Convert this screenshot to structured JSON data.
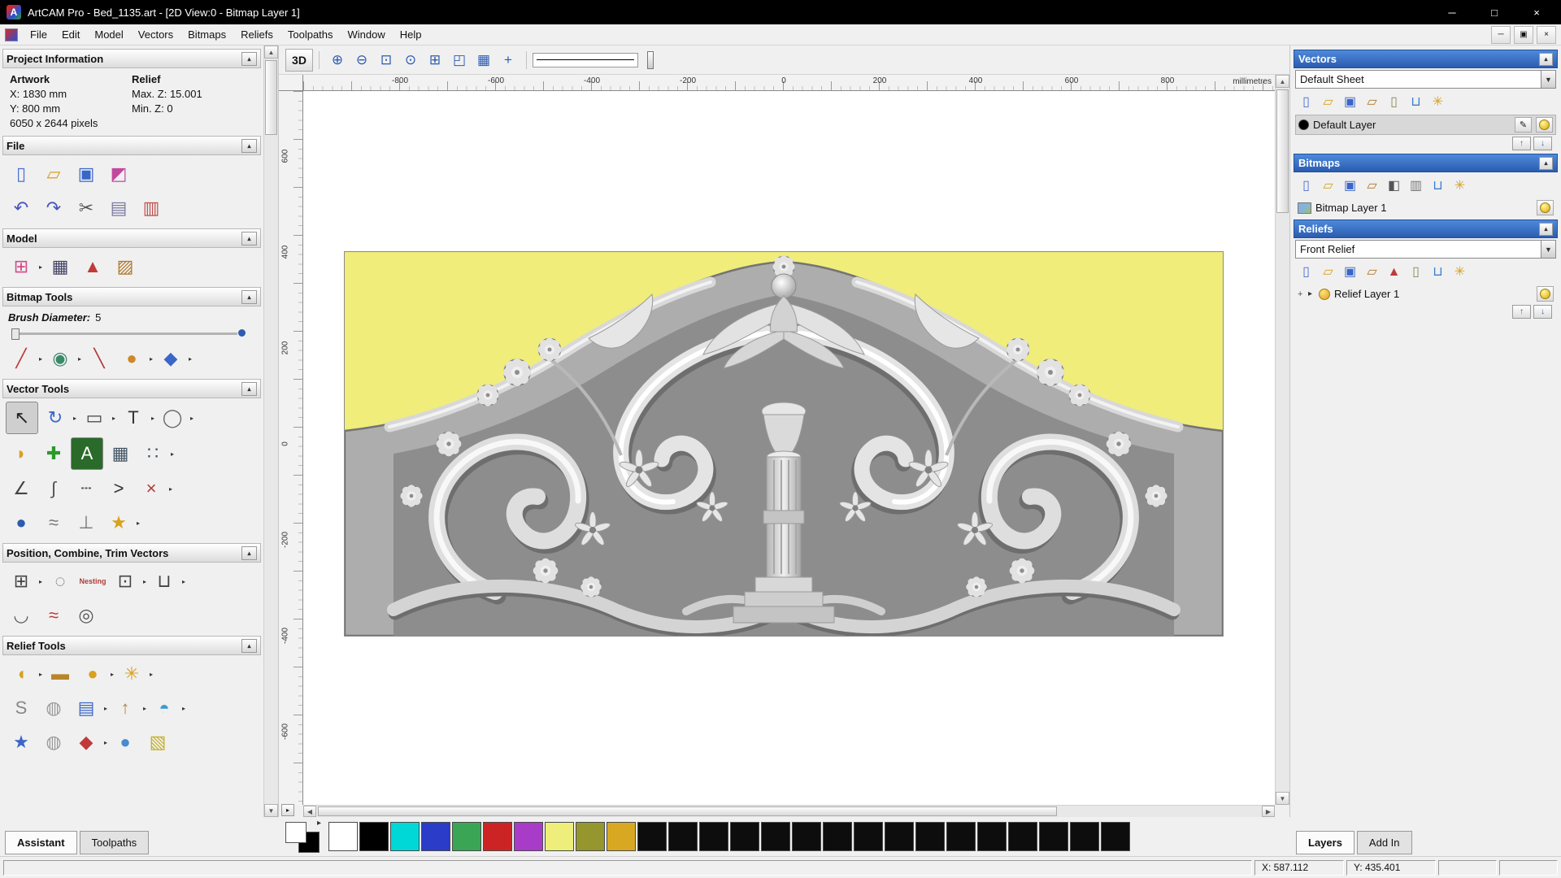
{
  "ui": {
    "rollup": "▴",
    "flyout": "▸",
    "dropdown": "▼",
    "up": "↑",
    "down": "↓",
    "uparrow": "▲",
    "downarrow": "▼",
    "left": "◀",
    "right": "▶",
    "expander": "▸",
    "plus": "+",
    "pencil": "✎",
    "pane": "▸"
  },
  "window": {
    "app_icon": "A",
    "title": "ArtCAM Pro - Bed_1135.art - [2D View:0 - Bitmap Layer 1]",
    "minimize": "─",
    "maximize": "□",
    "close": "×"
  },
  "menu": {
    "items": [
      {
        "name": "menu-file",
        "label": "File"
      },
      {
        "name": "menu-edit",
        "label": "Edit"
      },
      {
        "name": "menu-model",
        "label": "Model"
      },
      {
        "name": "menu-vectors",
        "label": "Vectors"
      },
      {
        "name": "menu-bitmaps",
        "label": "Bitmaps"
      },
      {
        "name": "menu-reliefs",
        "label": "Reliefs"
      },
      {
        "name": "menu-toolpaths",
        "label": "Toolpaths"
      },
      {
        "name": "menu-window",
        "label": "Window"
      },
      {
        "name": "menu-help",
        "label": "Help"
      }
    ],
    "mdi": {
      "minimize": "─",
      "restore": "▣",
      "close": "×"
    }
  },
  "left": {
    "project": {
      "title": "Project Information",
      "artwork": "Artwork",
      "relief": "Relief",
      "x": "X: 1830 mm",
      "y": "Y: 800 mm",
      "maxz": "Max. Z: 15.001",
      "minz": "Min. Z: 0",
      "pixels": "6050 x 2644 pixels"
    },
    "file": {
      "title": "File",
      "row1": [
        {
          "name": "new-model-icon",
          "g": "▯",
          "c": "#4a6fd0"
        },
        {
          "name": "open-model-icon",
          "g": "▱",
          "c": "#d9a11f"
        },
        {
          "name": "save-model-icon",
          "g": "▣",
          "c": "#3a66c8"
        },
        {
          "name": "export-model-icon",
          "g": "◩",
          "c": "#c2499e"
        }
      ],
      "row2": [
        {
          "name": "undo-icon",
          "g": "↶",
          "c": "#4a55c0"
        },
        {
          "name": "redo-icon",
          "g": "↷",
          "c": "#4a55c0"
        },
        {
          "name": "cut-icon",
          "g": "✂",
          "c": "#555555"
        },
        {
          "name": "copy-icon",
          "g": "▤",
          "c": "#7a7aa0"
        },
        {
          "name": "paste-icon",
          "g": "▥",
          "c": "#c0504d"
        }
      ]
    },
    "model": {
      "title": "Model",
      "row": [
        {
          "name": "set-model-size-icon",
          "g": "⊞",
          "c": "#d04b8a",
          "fly": true
        },
        {
          "name": "adjust-model-icon",
          "g": "▦",
          "c": "#444466"
        },
        {
          "name": "sculpt-figure-icon",
          "g": "▲",
          "c": "#c03a3a"
        },
        {
          "name": "model-from-image-icon",
          "g": "▨",
          "c": "#b0762a"
        }
      ]
    },
    "bitmap": {
      "title": "Bitmap Tools",
      "brush_label": "Brush Diameter:",
      "brush_value": "5",
      "row": [
        {
          "name": "paint-icon",
          "g": "╱",
          "c": "#c03a3a",
          "fly": true
        },
        {
          "name": "paint-selective-icon",
          "g": "◉",
          "c": "#3a8a6a",
          "fly": true
        },
        {
          "name": "colour-picker-icon",
          "g": "╲",
          "c": "#b03a3a"
        },
        {
          "name": "palette-icon",
          "g": "●",
          "c": "#d0862a",
          "fly": true
        },
        {
          "name": "flood-fill-icon",
          "g": "◆",
          "c": "#3a66c8",
          "fly": true
        }
      ]
    },
    "vector": {
      "title": "Vector Tools",
      "r1": [
        {
          "name": "select-vectors-icon",
          "g": "↖",
          "c": "#222222",
          "bg": "#cfcfcf"
        },
        {
          "name": "transform-vectors-icon",
          "g": "↻",
          "c": "#3a66c8",
          "fly": true
        },
        {
          "name": "create-rectangle-icon",
          "g": "▭",
          "c": "#444444",
          "fly": true
        },
        {
          "name": "create-text-icon",
          "g": "T",
          "c": "#333333",
          "fly": true
        },
        {
          "name": "create-ellipse-icon",
          "g": "◯",
          "c": "#666666",
          "fly": true
        }
      ],
      "r2": [
        {
          "name": "vector-doctor-icon",
          "g": "◗",
          "c": "#d9a11f"
        },
        {
          "name": "create-boundary-icon",
          "g": "✚",
          "c": "#2a9a2a"
        },
        {
          "name": "wrap-text-icon",
          "g": "A",
          "c": "#ffffff",
          "bg": "#2a6a2a"
        },
        {
          "name": "paste-along-curve-icon",
          "g": "▦",
          "c": "#445566"
        },
        {
          "name": "block-copy-icon",
          "g": "∷",
          "c": "#445566",
          "fly": true
        }
      ],
      "r3": [
        {
          "name": "create-polyline-icon",
          "g": "∠",
          "c": "#444444"
        },
        {
          "name": "free-polyline-icon",
          "g": "∫",
          "c": "#555555"
        },
        {
          "name": "node-editing-icon",
          "g": "┄",
          "c": "#555555"
        },
        {
          "name": "create-arrow-icon",
          "g": ">",
          "c": "#333333"
        },
        {
          "name": "trim-vectors-icon",
          "g": "×",
          "c": "#b03a3a",
          "fly": true
        }
      ],
      "r4": [
        {
          "name": "create-sphere-icon",
          "g": "●",
          "c": "#2a5cb0"
        },
        {
          "name": "wave-icon",
          "g": "≈",
          "c": "#777777"
        },
        {
          "name": "pedestal-icon",
          "g": "⊥",
          "c": "#777777"
        },
        {
          "name": "create-star-icon",
          "g": "★",
          "c": "#d9a11f",
          "fly": true
        }
      ]
    },
    "combine": {
      "title": "Position, Combine, Trim Vectors",
      "r1": [
        {
          "name": "align-vectors-icon",
          "g": "⊞",
          "c": "#444444",
          "fly": true
        },
        {
          "name": "circular-copy-icon",
          "g": "◌",
          "c": "#666666"
        },
        {
          "name": "nesting-icon",
          "g": "Nesting",
          "c": "#b03a3a",
          "small": true
        },
        {
          "name": "group-vectors-icon",
          "g": "⊡",
          "c": "#444444",
          "fly": true
        },
        {
          "name": "weld-vectors-icon",
          "g": "⊔",
          "c": "#444444",
          "fly": true
        }
      ],
      "r2": [
        {
          "name": "slice-vectors-icon",
          "g": "◡",
          "c": "#555555"
        },
        {
          "name": "distort-vectors-icon",
          "g": "≈",
          "c": "#c03a3a"
        },
        {
          "name": "spiral-icon",
          "g": "◎",
          "c": "#555555"
        }
      ]
    },
    "relief": {
      "title": "Relief Tools",
      "r1": [
        {
          "name": "shape-editor-icon",
          "g": "◖",
          "c": "#d9a11f",
          "fly": true
        },
        {
          "name": "smooth-relief-icon",
          "g": "▬",
          "c": "#b8862a"
        },
        {
          "name": "dome-tool-icon",
          "g": "●",
          "c": "#d9a11f",
          "fly": true
        },
        {
          "name": "sculpting-icon",
          "g": "✳",
          "c": "#d9a11f",
          "fly": true
        }
      ],
      "r2": [
        {
          "name": "swept-profile-icon",
          "g": "S",
          "c": "#888888"
        },
        {
          "name": "weave-wizard-icon",
          "g": "◍",
          "c": "#999999"
        },
        {
          "name": "relief-from-layers-icon",
          "g": "▤",
          "c": "#3a66c8",
          "fly": true
        },
        {
          "name": "emboss-icon",
          "g": "↑",
          "c": "#b8862a",
          "fly": true
        },
        {
          "name": "dome-relief-icon",
          "g": "◓",
          "c": "#3a9ad0",
          "fly": true
        }
      ],
      "r3": [
        {
          "name": "star-relief-icon",
          "g": "★",
          "c": "#3a66c8"
        },
        {
          "name": "texture-relief-icon",
          "g": "◍",
          "c": "#999999"
        },
        {
          "name": "paste-relief-icon",
          "g": "◆",
          "c": "#c03a3a",
          "fly": true
        },
        {
          "name": "texture-sphere-icon",
          "g": "●",
          "c": "#4a8ad0"
        },
        {
          "name": "offset-relief-icon",
          "g": "▧",
          "c": "#c2b02a"
        }
      ]
    },
    "tabs": [
      {
        "label": "Assistant"
      },
      {
        "label": "Toolpaths"
      }
    ]
  },
  "canvas": {
    "toolbar": {
      "view3d": "3D",
      "icons": [
        {
          "name": "zoom-in-icon",
          "g": "⊕",
          "c": "#2a5cb0"
        },
        {
          "name": "zoom-out-icon",
          "g": "⊖",
          "c": "#2a5cb0"
        },
        {
          "name": "zoom-box-icon",
          "g": "⊡",
          "c": "#2a5cb0"
        },
        {
          "name": "zoom-1to1-icon",
          "g": "⊙",
          "c": "#2a5cb0"
        },
        {
          "name": "zoom-fit-icon",
          "g": "⊞",
          "c": "#2a5cb0"
        },
        {
          "name": "zoom-object-icon",
          "g": "◰",
          "c": "#2a5cb0"
        },
        {
          "name": "snap-grid-icon",
          "g": "▦",
          "c": "#2a5cb0"
        },
        {
          "name": "toggle-origin-icon",
          "g": "+",
          "c": "#2a5cb0"
        }
      ]
    },
    "ruler": {
      "h": [
        "-800",
        "-600",
        "-400",
        "-200",
        "0",
        "200",
        "400",
        "600",
        "800"
      ],
      "v": [
        "600",
        "400",
        "200",
        "0",
        "-200",
        "-400",
        "-600"
      ],
      "unit": "millimetres"
    }
  },
  "right": {
    "vectors": {
      "title": "Vectors",
      "sheet": "Default Sheet",
      "layer": "Default Layer",
      "icons": [
        {
          "name": "new-vector-layer-icon",
          "g": "▯",
          "c": "#4a6fd0"
        },
        {
          "name": "open-vector-file-icon",
          "g": "▱",
          "c": "#d9a11f"
        },
        {
          "name": "save-vector-layer-icon",
          "g": "▣",
          "c": "#3a66c8"
        },
        {
          "name": "import-vectors-icon",
          "g": "▱",
          "c": "#b0762a"
        },
        {
          "name": "vector-sheet-icon",
          "g": "▯",
          "c": "#888855"
        },
        {
          "name": "delete-vector-layer-icon",
          "g": "⊔",
          "c": "#3a7fd0"
        },
        {
          "name": "merge-vector-layers-icon",
          "g": "✳",
          "c": "#d9a11f"
        }
      ]
    },
    "bitmaps": {
      "title": "Bitmaps",
      "layer": "Bitmap Layer 1",
      "icons": [
        {
          "name": "new-bitmap-layer-icon",
          "g": "▯",
          "c": "#4a6fd0"
        },
        {
          "name": "open-bitmap-file-icon",
          "g": "▱",
          "c": "#d9a11f"
        },
        {
          "name": "save-bitmap-layer-icon",
          "g": "▣",
          "c": "#3a66c8"
        },
        {
          "name": "import-bitmap-icon",
          "g": "▱",
          "c": "#b0762a"
        },
        {
          "name": "contrast-icon",
          "g": "◧",
          "c": "#555555"
        },
        {
          "name": "combine-bitmaps-icon",
          "g": "▥",
          "c": "#777777"
        },
        {
          "name": "delete-bitmap-layer-icon",
          "g": "⊔",
          "c": "#3a7fd0"
        },
        {
          "name": "merge-bitmap-layers-icon",
          "g": "✳",
          "c": "#d9a11f"
        }
      ]
    },
    "reliefs": {
      "title": "Reliefs",
      "combo": "Front Relief",
      "layer": "Relief Layer 1",
      "icons": [
        {
          "name": "new-relief-layer-icon",
          "g": "▯",
          "c": "#4a6fd0"
        },
        {
          "name": "open-relief-file-icon",
          "g": "▱",
          "c": "#d9a11f"
        },
        {
          "name": "save-relief-layer-icon",
          "g": "▣",
          "c": "#3a66c8"
        },
        {
          "name": "import-relief-icon",
          "g": "▱",
          "c": "#b0762a"
        },
        {
          "name": "scale-relief-icon",
          "g": "▲",
          "c": "#c03a3a"
        },
        {
          "name": "relief-sheet-icon",
          "g": "▯",
          "c": "#888855"
        },
        {
          "name": "delete-relief-layer-icon",
          "g": "⊔",
          "c": "#3a7fd0"
        },
        {
          "name": "relief-wizard-icon",
          "g": "✳",
          "c": "#d9a11f"
        }
      ]
    },
    "tabs": [
      {
        "label": "Layers"
      },
      {
        "label": "Add In"
      }
    ]
  },
  "palette": {
    "primary": "#ffffff",
    "secondary": "#000000",
    "colors": [
      "#ffffff",
      "#000000",
      "#00d8d8",
      "#2a3cc8",
      "#3aa655",
      "#cc2424",
      "#a83cc8",
      "#eeee7a",
      "#96962e",
      "#d8a822",
      "#0d0d0d",
      "#0d0d0d",
      "#0d0d0d",
      "#0d0d0d",
      "#0d0d0d",
      "#0d0d0d",
      "#0d0d0d",
      "#0d0d0d",
      "#0d0d0d",
      "#0d0d0d",
      "#0d0d0d",
      "#0d0d0d",
      "#0d0d0d",
      "#0d0d0d",
      "#0d0d0d",
      "#0d0d0d"
    ]
  },
  "status": {
    "x": "X: 587.112",
    "y": "Y: 435.401"
  }
}
